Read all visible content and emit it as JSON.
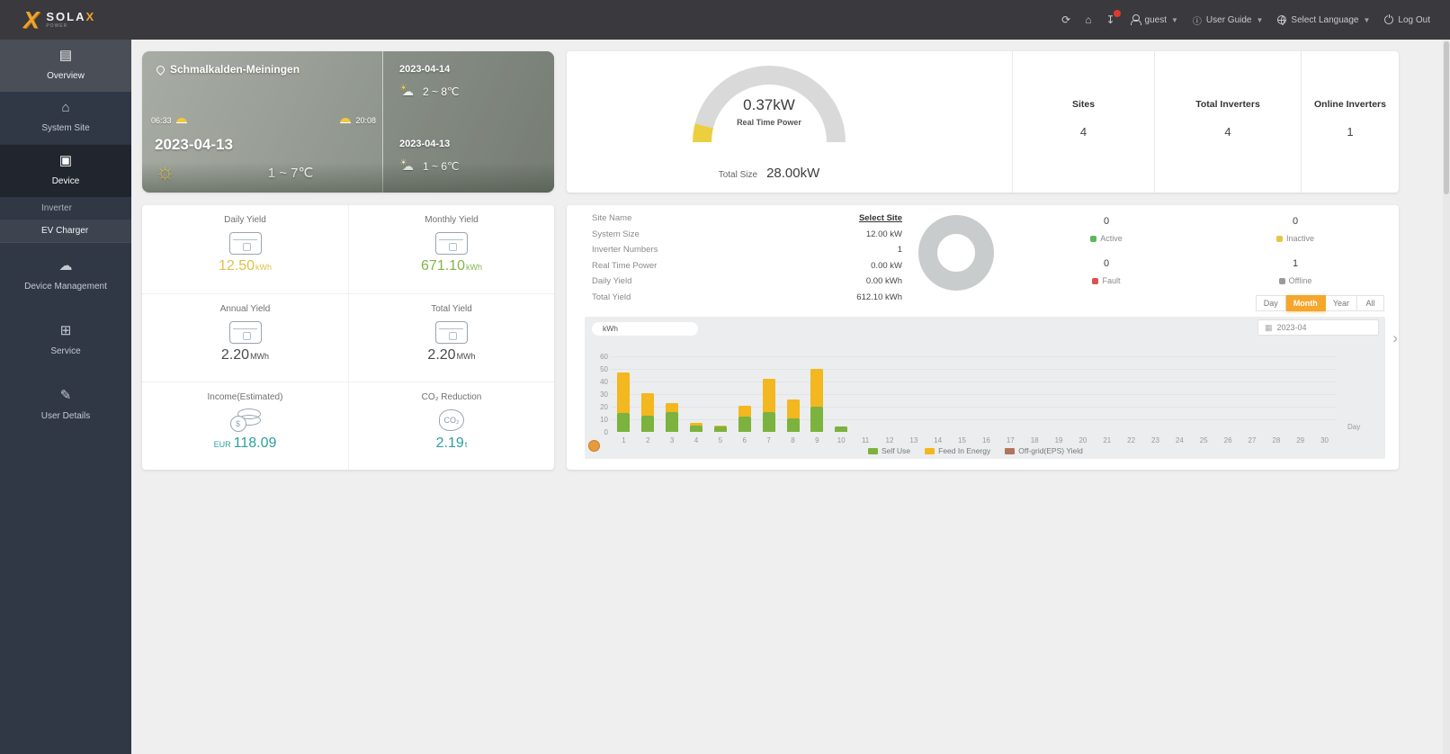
{
  "header": {
    "brand": {
      "name_main": "SOLA",
      "name_accent": "X",
      "sub": "POWER"
    },
    "icons": [
      {
        "name": "refresh-icon",
        "glyph": "⟳"
      },
      {
        "name": "home-icon",
        "glyph": "⌂"
      },
      {
        "name": "download-icon",
        "glyph": "↧",
        "badge": true
      }
    ],
    "user": "guest",
    "user_guide": "User Guide",
    "select_language": "Select Language",
    "log_out": "Log Out"
  },
  "sidebar": {
    "items": [
      {
        "id": "overview",
        "label": "Overview",
        "icon": "▤",
        "state": "light"
      },
      {
        "id": "system-site",
        "label": "System Site",
        "icon": "⌂",
        "state": ""
      },
      {
        "id": "device",
        "label": "Device",
        "icon": "▣",
        "state": "active",
        "children": [
          {
            "label": "Inverter",
            "on": false
          },
          {
            "label": "EV Charger",
            "on": true
          }
        ]
      },
      {
        "id": "device-management",
        "label": "Device Management",
        "icon": "☁",
        "state": "",
        "gap": "gap8"
      },
      {
        "id": "service",
        "label": "Service",
        "icon": "⊞",
        "state": "",
        "gap": "gap16"
      },
      {
        "id": "user-details",
        "label": "User Details",
        "icon": "✎",
        "state": "",
        "gap": "gap16"
      }
    ]
  },
  "weather": {
    "location": "Schmalkalden-Meiningen",
    "sunrise": "06:33",
    "sunset": "20:08",
    "today": {
      "date": "2023-04-13",
      "temp": "1 ~ 7℃"
    },
    "forecast": [
      {
        "date": "2023-04-14",
        "temp": "2 ~ 8℃"
      },
      {
        "date": "2023-04-13",
        "temp": "1 ~ 6℃"
      }
    ]
  },
  "gauge": {
    "value": "0.37kW",
    "label": "Real Time Power",
    "total_label": "Total Size",
    "total_value": "28.00kW",
    "percent": 8,
    "arc_color": "#d9d9d9",
    "fill_color": "#eccf3f"
  },
  "stats": [
    {
      "label": "Sites",
      "value": "4"
    },
    {
      "label": "Total Inverters",
      "value": "4"
    },
    {
      "label": "Online Inverters",
      "value": "1"
    }
  ],
  "yields": [
    {
      "label": "Daily Yield",
      "value": "12.50",
      "unit": "kWh",
      "prefix": "",
      "color": "#dfc04a",
      "icon": "meter"
    },
    {
      "label": "Monthly Yield",
      "value": "671.10",
      "unit": "kWh",
      "prefix": "",
      "color": "#83b54a",
      "icon": "meter"
    },
    {
      "label": "Annual Yield",
      "value": "2.20",
      "unit": "MWh",
      "prefix": "",
      "color": "#4a4a4a",
      "icon": "meter"
    },
    {
      "label": "Total Yield",
      "value": "2.20",
      "unit": "MWh",
      "prefix": "",
      "color": "#4a4a4a",
      "icon": "meter"
    },
    {
      "label": "Income(Estimated)",
      "value": "118.09",
      "unit": "",
      "prefix": "EUR",
      "color": "#2f9e9e",
      "icon": "coins"
    },
    {
      "label": "CO₂ Reduction",
      "value": "2.19",
      "unit": "t",
      "prefix": "",
      "color": "#2f9e9e",
      "icon": "co2"
    }
  ],
  "site_info": {
    "rows": [
      {
        "label": "Site Name",
        "value": "Select Site",
        "link": true
      },
      {
        "label": "System Size",
        "value": "12.00 kW",
        "link": false
      },
      {
        "label": "Inverter Numbers",
        "value": "1",
        "link": false
      },
      {
        "label": "Real Time Power",
        "value": "0.00 kW",
        "link": false
      },
      {
        "label": "Daily Yield",
        "value": "0.00 kWh",
        "link": false
      },
      {
        "label": "Total Yield",
        "value": "612.10 kWh",
        "link": false
      }
    ],
    "statuses": [
      {
        "label": "Active",
        "value": "0",
        "color": "#5cb85c"
      },
      {
        "label": "Inactive",
        "value": "0",
        "color": "#e7c545"
      },
      {
        "label": "Fault",
        "value": "0",
        "color": "#d9534f"
      },
      {
        "label": "Offline",
        "value": "1",
        "color": "#9b9b9b"
      }
    ]
  },
  "period": {
    "tabs": [
      "Day",
      "Month",
      "Year",
      "All"
    ],
    "active": "Month",
    "date_value": "2023-04",
    "calendar_icon": "▦"
  },
  "chart_data": {
    "type": "bar",
    "stacked": true,
    "unit": "kWh",
    "xlabel": "Day",
    "x": [
      1,
      2,
      3,
      4,
      5,
      6,
      7,
      8,
      9,
      10,
      11,
      12,
      13,
      14,
      15,
      16,
      17,
      18,
      19,
      20,
      21,
      22,
      23,
      24,
      25,
      26,
      27,
      28,
      29,
      30
    ],
    "ylim": [
      0,
      60
    ],
    "yticks": [
      0,
      10,
      20,
      30,
      40,
      50,
      60
    ],
    "grid": true,
    "legend_position": "bottom",
    "series": [
      {
        "name": "Self Use",
        "color": "#7cb23e",
        "values": [
          15,
          13,
          16,
          5,
          4,
          12,
          16,
          11,
          20,
          4,
          0,
          0,
          0,
          0,
          0,
          0,
          0,
          0,
          0,
          0,
          0,
          0,
          0,
          0,
          0,
          0,
          0,
          0,
          0,
          0
        ]
      },
      {
        "name": "Feed In Energy",
        "color": "#f3b71f",
        "values": [
          32,
          18,
          7,
          2,
          1,
          9,
          26,
          15,
          30,
          0,
          0,
          0,
          0,
          0,
          0,
          0,
          0,
          0,
          0,
          0,
          0,
          0,
          0,
          0,
          0,
          0,
          0,
          0,
          0,
          0
        ]
      },
      {
        "name": "Off-grid(EPS) Yield",
        "color": "#b0765b",
        "values": [
          0,
          0,
          0,
          0,
          0,
          0,
          0,
          0,
          0,
          0,
          0,
          0,
          0,
          0,
          0,
          0,
          0,
          0,
          0,
          0,
          0,
          0,
          0,
          0,
          0,
          0,
          0,
          0,
          0,
          0
        ]
      }
    ]
  }
}
